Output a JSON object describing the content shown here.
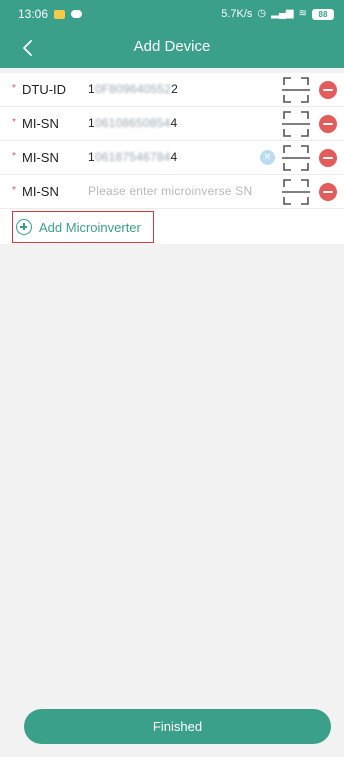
{
  "status_bar": {
    "time": "13:06",
    "network_speed": "5.7K/s",
    "battery": "88"
  },
  "header": {
    "title": "Add Device"
  },
  "form": {
    "required_mark": "*",
    "dtu": {
      "label": "DTU-ID",
      "value_start": "1",
      "value_hidden": "0F809640552",
      "value_end": "2"
    },
    "mi_rows": [
      {
        "label": "MI-SN",
        "value_start": "1",
        "value_hidden": "06108650854",
        "value_end": "4",
        "placeholder": ""
      },
      {
        "label": "MI-SN",
        "value_start": "1",
        "value_hidden": "06187546784",
        "value_end": "4",
        "placeholder": ""
      },
      {
        "label": "MI-SN",
        "value_start": "",
        "value_hidden": "",
        "value_end": "",
        "placeholder": "Please enter microinverse SN"
      }
    ],
    "add_button_label": "Add Microinverter"
  },
  "footer": {
    "finished_label": "Finished"
  },
  "icons": {
    "back": "chevron-left-icon",
    "scan": "scan-icon",
    "remove": "remove-icon",
    "clear": "clear-icon",
    "add": "plus-circle-icon"
  },
  "colors": {
    "primary": "#3aa08a",
    "remove": "#e35b5b",
    "required": "#e35656",
    "clear": "#b9dcf2"
  }
}
